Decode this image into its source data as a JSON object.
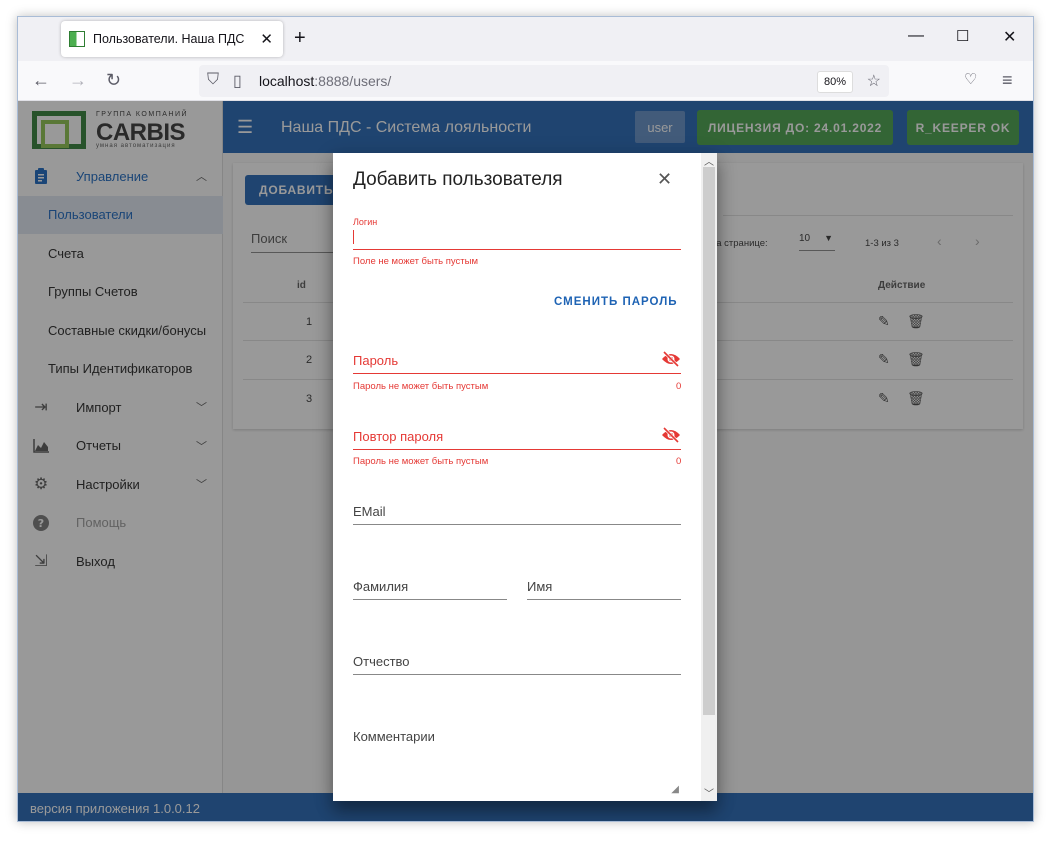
{
  "browser": {
    "tab_title": "Пользователи. Наша ПДС",
    "url_host": "localhost",
    "url_rest": ":8888/users/",
    "zoom": "80%"
  },
  "logo": {
    "top": "ГРУППА КОМПАНИЙ",
    "main": "CARBIS",
    "sub": "умная автоматизация"
  },
  "sidebar": {
    "items": [
      {
        "label": "Управление",
        "icon": "clipboard-icon"
      },
      {
        "label": "Пользователи"
      },
      {
        "label": "Счета"
      },
      {
        "label": "Группы Счетов"
      },
      {
        "label": "Составные скидки/бонусы"
      },
      {
        "label": "Типы Идентификаторов"
      },
      {
        "label": "Импорт",
        "icon": "import-icon"
      },
      {
        "label": "Отчеты",
        "icon": "chart-icon"
      },
      {
        "label": "Настройки",
        "icon": "gear-icon"
      },
      {
        "label": "Помощь",
        "icon": "help-icon"
      },
      {
        "label": "Выход",
        "icon": "logout-icon"
      }
    ]
  },
  "header": {
    "title": "Наша ПДС - Система лояльности",
    "user": "user",
    "license": "ЛИЦЕНЗИЯ ДО: 24.01.2022",
    "rkeeper": "R_KEEPER OK"
  },
  "table": {
    "add_button": "ДОБАВИТЬ ПОЛЬЗОВАТЕЛЯ",
    "search_label": "Поиск",
    "per_page_label": "на странице:",
    "per_page_value": "10",
    "range": "1-3 из 3",
    "columns": [
      "id",
      "Действие"
    ],
    "rows": [
      {
        "id": "1"
      },
      {
        "id": "2"
      },
      {
        "id": "3"
      }
    ]
  },
  "dialog": {
    "title": "Добавить пользователя",
    "login_label": "Логин",
    "login_error": "Поле не может быть пустым",
    "change_password": "СМЕНИТЬ ПАРОЛЬ",
    "password_label": "Пароль",
    "password_error": "Пароль не может быть пустым",
    "password_counter": "0",
    "repeat_label": "Повтор пароля",
    "repeat_error": "Пароль не может быть пустым",
    "repeat_counter": "0",
    "email_label": "EMail",
    "lastname_label": "Фамилия",
    "firstname_label": "Имя",
    "middlename_label": "Отчество",
    "comment_label": "Комментарии"
  },
  "footer": {
    "version": "версия приложения 1.0.0.12"
  },
  "colors": {
    "primary": "#1e63b4",
    "success": "#43a047",
    "error": "#e53935"
  }
}
